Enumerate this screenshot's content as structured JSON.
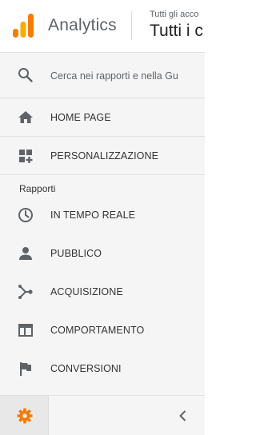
{
  "header": {
    "app_name": "Analytics",
    "account_small": "Tutti gli acco",
    "account_big": "Tutti i c"
  },
  "search": {
    "placeholder": "Cerca nei rapporti e nella Gu"
  },
  "nav": {
    "home": "HOME PAGE",
    "customization": "PERSONALIZZAZIONE"
  },
  "reports": {
    "section_title": "Rapporti",
    "items": [
      {
        "label": "IN TEMPO REALE",
        "icon": "clock-icon"
      },
      {
        "label": "PUBBLICO",
        "icon": "person-icon"
      },
      {
        "label": "ACQUISIZIONE",
        "icon": "acquisition-icon"
      },
      {
        "label": "COMPORTAMENTO",
        "icon": "behavior-icon"
      },
      {
        "label": "CONVERSIONI",
        "icon": "flag-icon"
      }
    ]
  },
  "colors": {
    "accent_orange": "#F57C00",
    "logo_light": "#FBBC04",
    "icon_gray": "#5f6368",
    "sidebar_bg": "#f5f5f5"
  }
}
